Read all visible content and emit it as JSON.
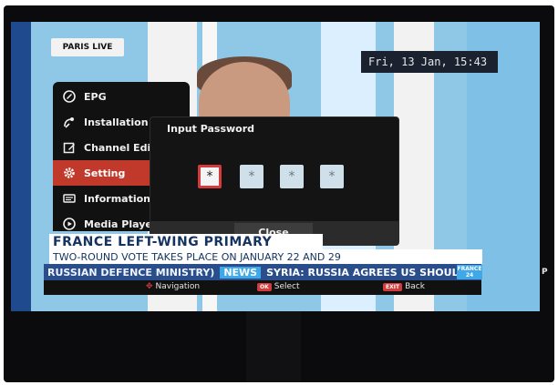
{
  "channel_logo": {
    "text": "PARIS LIVE"
  },
  "clock": {
    "text": "Fri, 13 Jan, 15:43"
  },
  "main_menu": {
    "items": [
      {
        "label": "EPG",
        "icon": "epg-icon"
      },
      {
        "label": "Installation",
        "icon": "satellite-icon"
      },
      {
        "label": "Channel Edit",
        "icon": "edit-icon"
      },
      {
        "label": "Setting",
        "icon": "gear-icon"
      },
      {
        "label": "Information",
        "icon": "information-icon"
      },
      {
        "label": "Media Player",
        "icon": "play-icon"
      }
    ],
    "active_index": 3
  },
  "password_dialog": {
    "title": "Input Password",
    "pin_placeholder": "*",
    "close_label": "Close"
  },
  "news": {
    "headline": "FRANCE LEFT-WING PRIMARY",
    "subheadline": "TWO-ROUND VOTE TAKES PLACE ON JANUARY 22 AND 29",
    "ticker_left": "RUSSIAN DEFENCE MINISTRY)",
    "ticker_tag": "NEWS",
    "ticker_right": "SYRIA: RUSSIA AGREES US SHOULD A",
    "badge_line1": "FRANCE",
    "badge_line2": "24"
  },
  "help_bar": {
    "navigation_label": "Navigation",
    "ok_key": "OK",
    "select_label": "Select",
    "exit_key": "EXIT",
    "back_label": "Back"
  },
  "side_text": "P",
  "colors": {
    "accent_red": "#d33c3c",
    "menu_bg": "#111111",
    "ticker_blue": "#2a4d8c"
  }
}
